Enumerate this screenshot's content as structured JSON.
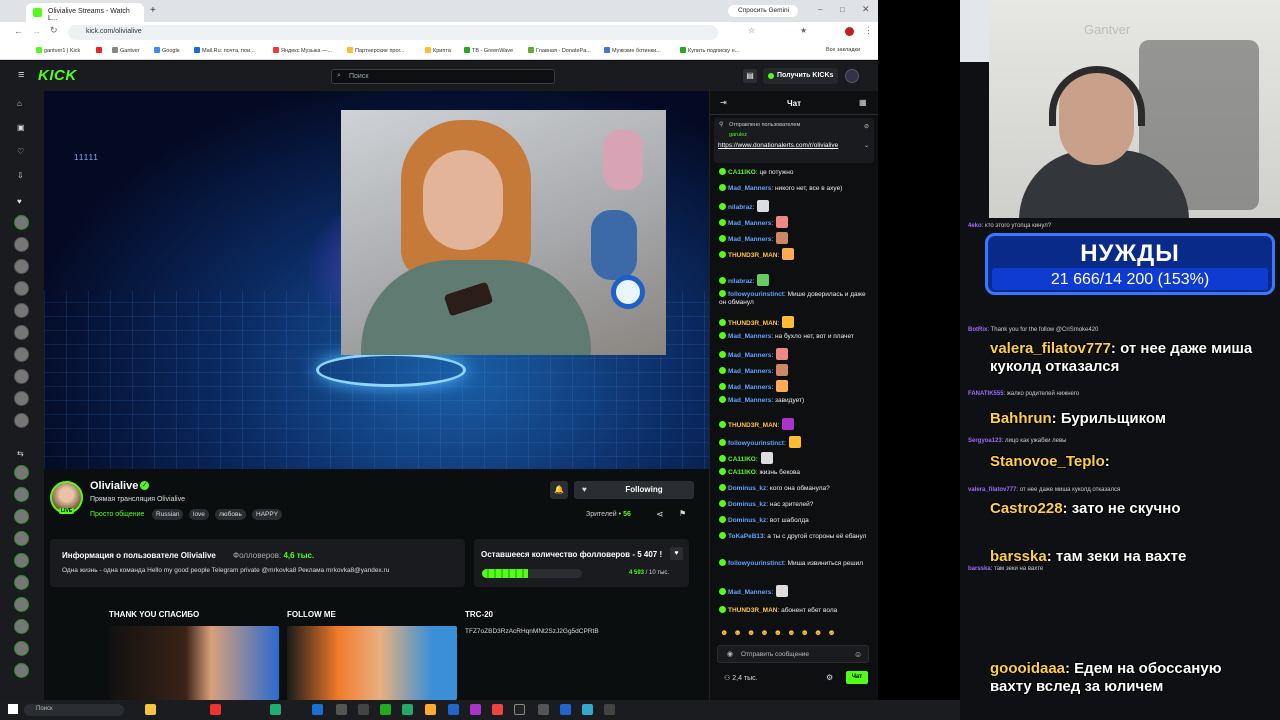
{
  "browser": {
    "tab_title": "Olivialive Streams - Watch L...",
    "new_tab": "+",
    "url": "kick.com/olivialive",
    "gemini": "Спросить Gemini",
    "bookmarks": [
      "gantver1 | Kick",
      "Google",
      "Mail.Ru: почта, пои...",
      "Яндекс Музыка —...",
      "Партнерские прог...",
      "Крипта",
      "TB - GreenWave",
      "Главная - DonatePa...",
      "Мужские ботинки...",
      "Купить подписку н...",
      "Все закладки"
    ]
  },
  "kick_nav": {
    "logo": "KICK",
    "search_placeholder": "Поиск",
    "get_kicks": "Получить KICKs"
  },
  "video": {
    "overlay_text": "11111"
  },
  "stream": {
    "streamer": "Olivialive",
    "title": "Прямая трансляция Olivialive",
    "category": "Просто общение",
    "tags": [
      "Russian",
      "love",
      "любовь",
      "HAPPY"
    ],
    "follow_label": "Following",
    "viewers_label": "Зрителей",
    "viewers_count": "56",
    "live_badge": "LIVE"
  },
  "about": {
    "title": "Информация о пользователе Olivialive",
    "followers_label": "Фолловеров:",
    "followers_count": "4,6 тыс.",
    "bio": "Одна жизнь - одна команда Hello my good people   Telegram private @mrkovka8 Реклама mrkovka8@yandex.ru"
  },
  "goal": {
    "title": "Оставшееся количество фолловеров - 5 407 !",
    "progress_fraction": 0.46,
    "count": "4 593",
    "target": "10 тыс."
  },
  "panels": [
    {
      "title": "THANK YOU СПАСИБО"
    },
    {
      "title": "FOLLOW ME"
    },
    {
      "title": "TRC-20",
      "text": "TFZ7oZBD3RzAcRHqnMNt2SzJ2Gg5dCPRtB"
    }
  ],
  "chat": {
    "title": "Чат",
    "pinned_label": "Отправлено пользователем",
    "pinned_user": "garulez",
    "pinned_link": "https://www.donationalerts.com/r/olivialive",
    "messages": [
      {
        "user": "CA11IKO",
        "color": "#53fc18",
        "text": ": це потужно"
      },
      {
        "user": "Mad_Manners",
        "color": "#5ea3ff",
        "text": ": никого нет, все в ахуе)"
      },
      {
        "user": "nilabraz",
        "color": "#5ea3ff",
        "text": ":"
      },
      {
        "user": "Mad_Manners",
        "color": "#5ea3ff",
        "text": ":"
      },
      {
        "user": "Mad_Manners",
        "color": "#5ea3ff",
        "text": ":"
      },
      {
        "user": "THUND3R_MAN",
        "color": "#ffc440",
        "text": ":"
      },
      {
        "user": "nilabraz",
        "color": "#5ea3ff",
        "text": ":"
      },
      {
        "user": "followyourinstinct",
        "color": "#5ea3ff",
        "text": ": Мише доверилась и даже он обманул"
      },
      {
        "user": "THUND3R_MAN",
        "color": "#ffc440",
        "text": ":"
      },
      {
        "user": "Mad_Manners",
        "color": "#5ea3ff",
        "text": ": на бухло нет, вот и плачет"
      },
      {
        "user": "Mad_Manners",
        "color": "#5ea3ff",
        "text": ":"
      },
      {
        "user": "Mad_Manners",
        "color": "#5ea3ff",
        "text": ":"
      },
      {
        "user": "Mad_Manners",
        "color": "#5ea3ff",
        "text": ":"
      },
      {
        "user": "Mad_Manners",
        "color": "#5ea3ff",
        "text": ": завидует)"
      },
      {
        "user": "THUND3R_MAN",
        "color": "#ffc440",
        "text": ":"
      },
      {
        "user": "followyourinstinct",
        "color": "#5ea3ff",
        "text": ":"
      },
      {
        "user": "CA11IKO",
        "color": "#53fc18",
        "text": ":"
      },
      {
        "user": "CA11IKO",
        "color": "#53fc18",
        "text": ": жизнь бекова"
      },
      {
        "user": "Dominus_kz",
        "color": "#5ea3ff",
        "text": ": кого она обманула?"
      },
      {
        "user": "Dominus_kz",
        "color": "#5ea3ff",
        "text": ": нас зрителей?"
      },
      {
        "user": "Dominus_kz",
        "color": "#5ea3ff",
        "text": ": вот шаболда"
      },
      {
        "user": "ToKaPeB13",
        "color": "#5ea3ff",
        "text": ": а ты с другой стороны её ебанул"
      },
      {
        "user": "followyourinstinct",
        "color": "#5ea3ff",
        "text": ": Миша извиниться решил"
      },
      {
        "user": "Mad_Manners",
        "color": "#5ea3ff",
        "text": ":"
      },
      {
        "user": "THUND3R_MAN",
        "color": "#ffc440",
        "text": ": абонент ебет вола"
      }
    ],
    "input_placeholder": "Отправить сообщение",
    "viewers": "2,4 тыс.",
    "send_label": "Чат"
  },
  "right": {
    "watermark": "Gantver",
    "needs_title": "НУЖДЫ",
    "needs_count": "21 666/14 200 (153%)",
    "small_msgs": [
      {
        "user": "4eko",
        "text": ": кто этого утопца кинул?"
      },
      {
        "user": "BotRix",
        "text": ": Thank you for the follow @CriSmoke420"
      },
      {
        "user": "FANATIK555",
        "text": ": жалко родителей нижнего"
      },
      {
        "user": "Sergyoa123",
        "text": ": лицо как ужабки левы"
      },
      {
        "user": "valera_filatov777",
        "text": ": от нее даже миша куколд отказался"
      },
      {
        "user": "barsska",
        "text": ": там зеки на вахте"
      }
    ],
    "big_msgs": [
      {
        "user": "valera_filatov777",
        "text": ": от нее даже миша куколд отказался"
      },
      {
        "user": "Bahhrun",
        "text": ": Бурильщиком"
      },
      {
        "user": "Stanovoe_Teplo",
        "text": ":"
      },
      {
        "user": "Castro228",
        "text": ": зато не скучно"
      },
      {
        "user": "barsska",
        "text": ": там зеки на вахте"
      },
      {
        "user": "goooidaaa",
        "text": ": Едем на обоссаную вахту вслед за юличем"
      }
    ]
  },
  "taskbar": {
    "search": "Поиск"
  },
  "colors": {
    "kick_green": "#53fc18",
    "needs_blue": "#0a2a8a"
  }
}
